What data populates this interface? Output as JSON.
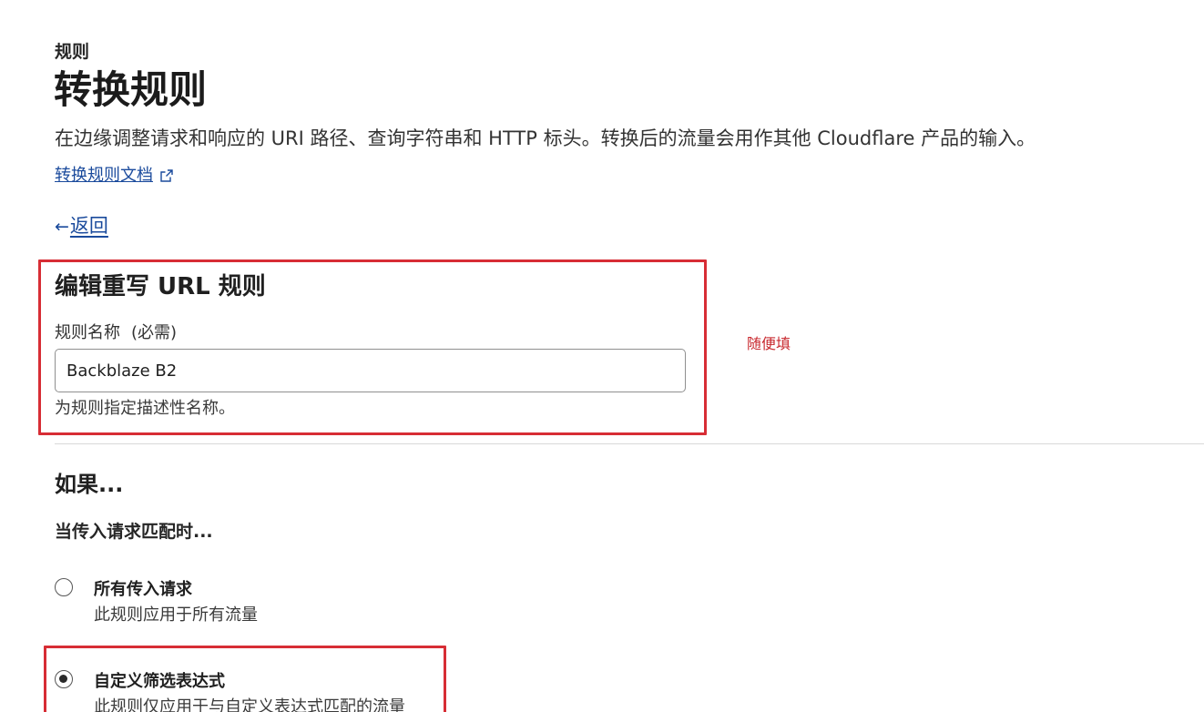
{
  "header": {
    "breadcrumb": "规则",
    "title": "转换规则",
    "description": "在边缘调整请求和响应的 URI 路径、查询字符串和 HTTP 标头。转换后的流量会用作其他 Cloudflare 产品的输入。",
    "docs_link": "转换规则文档",
    "back_arrow": "←",
    "back_label": "返回"
  },
  "edit_section": {
    "title": "编辑重写 URL 规则",
    "name_label": "规则名称",
    "required_note": "(必需)",
    "name_value": "Backblaze B2",
    "name_help": "为规则指定描述性名称。"
  },
  "annotation": {
    "text": "随便填",
    "color": "#c8282e"
  },
  "condition_section": {
    "heading": "如果...",
    "subheading": "当传入请求匹配时...",
    "options": [
      {
        "label": "所有传入请求",
        "description": "此规则应用于所有流量",
        "selected": false
      },
      {
        "label": "自定义筛选表达式",
        "description": "此规则仅应用于与自定义表达式匹配的流量",
        "selected": true
      }
    ]
  },
  "colors": {
    "link": "#1a4a9c",
    "highlight": "#d72d35"
  },
  "icons": {
    "external": "external-link-icon",
    "back": "arrow-left-icon"
  }
}
